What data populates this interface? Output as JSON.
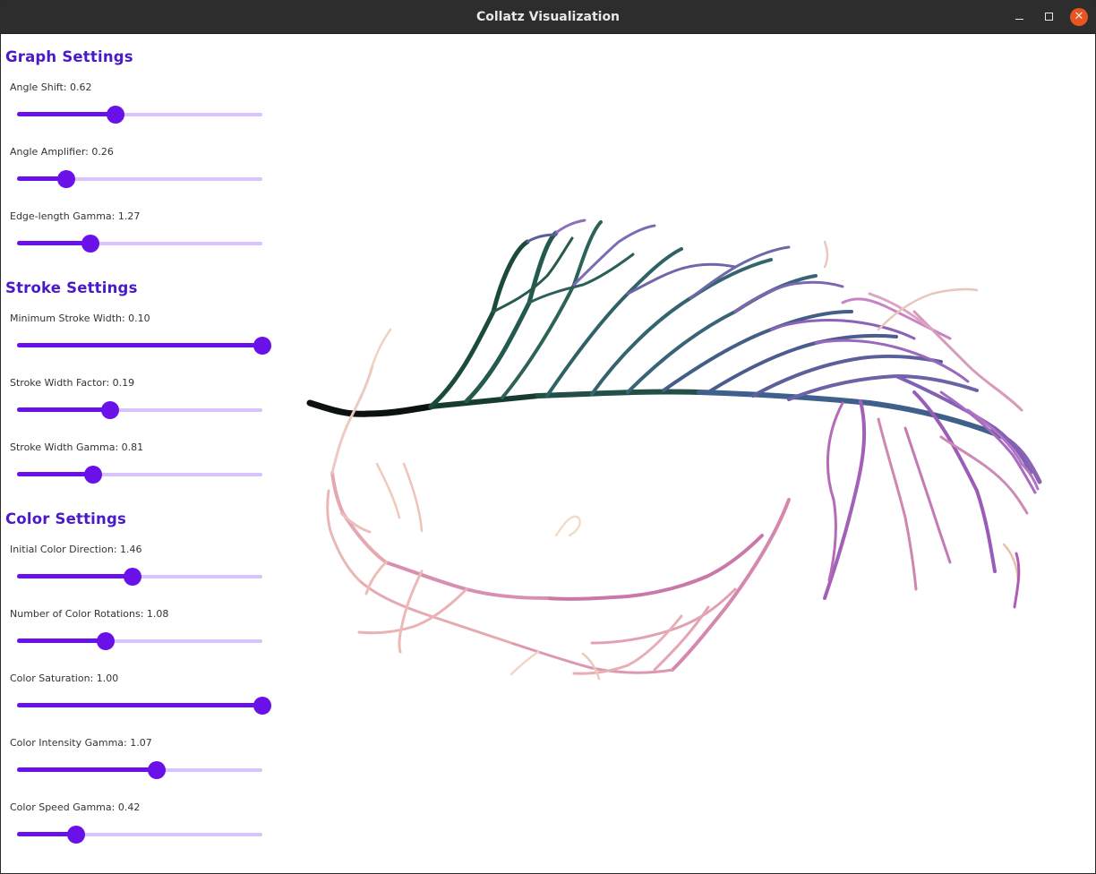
{
  "window": {
    "title": "Collatz Visualization"
  },
  "colors": {
    "accent": "#6a10e8",
    "track": "#d8c4fa",
    "section_title": "#4a1ac9",
    "close_button": "#e95420"
  },
  "sections": [
    {
      "title": "Graph Settings",
      "controls": [
        {
          "label": "Angle Shift: 0.62",
          "fraction": 0.4
        },
        {
          "label": "Angle Amplifier: 0.26",
          "fraction": 0.2
        },
        {
          "label": "Edge-length Gamma: 1.27",
          "fraction": 0.3
        }
      ]
    },
    {
      "title": "Stroke Settings",
      "controls": [
        {
          "label": "Minimum Stroke Width: 0.10",
          "fraction": 1.0
        },
        {
          "label": "Stroke Width Factor: 0.19",
          "fraction": 0.38
        },
        {
          "label": "Stroke Width Gamma: 0.81",
          "fraction": 0.31
        }
      ]
    },
    {
      "title": "Color Settings",
      "controls": [
        {
          "label": "Initial Color Direction: 1.46",
          "fraction": 0.47
        },
        {
          "label": "Number of Color Rotations: 1.08",
          "fraction": 0.36
        },
        {
          "label": "Color Saturation: 1.00",
          "fraction": 1.0
        },
        {
          "label": "Color Intensity Gamma: 1.07",
          "fraction": 0.57
        },
        {
          "label": "Color Speed Gamma: 0.42",
          "fraction": 0.24
        }
      ]
    }
  ]
}
